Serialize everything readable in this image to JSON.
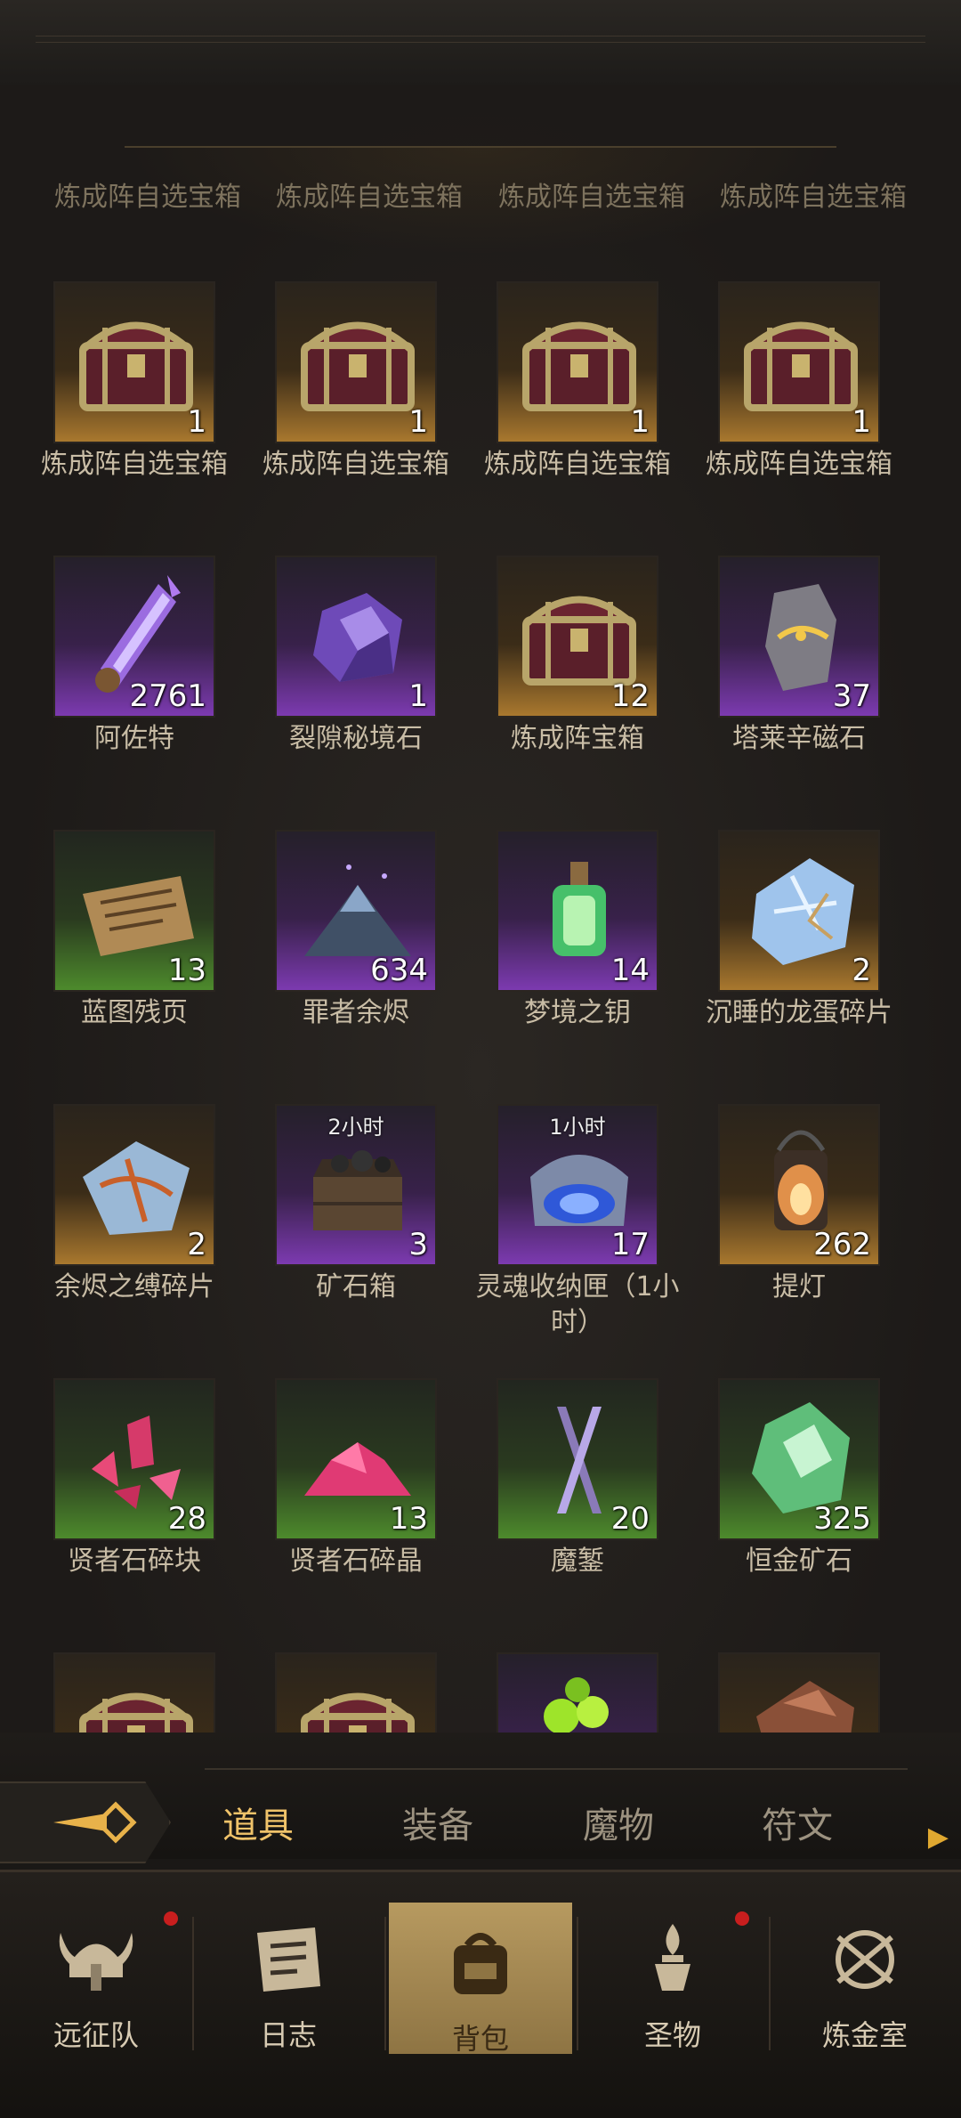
{
  "partial_row": [
    "炼成阵自选宝箱",
    "炼成阵自选宝箱",
    "炼成阵自选宝箱",
    "炼成阵自选宝箱"
  ],
  "items": [
    {
      "name": "炼成阵自选宝箱",
      "count": "1",
      "rarity": "gold",
      "icon": "treasure-chest-icon"
    },
    {
      "name": "炼成阵自选宝箱",
      "count": "1",
      "rarity": "gold",
      "icon": "treasure-chest-icon"
    },
    {
      "name": "炼成阵自选宝箱",
      "count": "1",
      "rarity": "gold",
      "icon": "treasure-chest-icon"
    },
    {
      "name": "炼成阵自选宝箱",
      "count": "1",
      "rarity": "gold",
      "icon": "treasure-chest-icon"
    },
    {
      "name": "阿佐特",
      "count": "2761",
      "rarity": "purple",
      "icon": "crystal-vial-icon"
    },
    {
      "name": "裂隙秘境石",
      "count": "1",
      "rarity": "purple",
      "icon": "amethyst-stone-icon"
    },
    {
      "name": "炼成阵宝箱",
      "count": "12",
      "rarity": "gold",
      "icon": "treasure-chest-icon"
    },
    {
      "name": "塔莱辛磁石",
      "count": "37",
      "rarity": "purple",
      "icon": "rune-stone-icon"
    },
    {
      "name": "蓝图残页",
      "count": "13",
      "rarity": "green",
      "icon": "scroll-page-icon"
    },
    {
      "name": "罪者余烬",
      "count": "634",
      "rarity": "purple",
      "icon": "ash-pile-icon"
    },
    {
      "name": "梦境之钥",
      "count": "14",
      "rarity": "purple",
      "icon": "green-lantern-vial-icon"
    },
    {
      "name": "沉睡的龙蛋碎片",
      "count": "2",
      "rarity": "gold",
      "icon": "dragon-egg-shard-icon"
    },
    {
      "name": "余烬之缚碎片",
      "count": "2",
      "rarity": "gold",
      "icon": "ember-shard-icon"
    },
    {
      "name": "矿石箱",
      "count": "3",
      "rarity": "purple",
      "icon": "ore-crate-icon",
      "timer": "2小时"
    },
    {
      "name": "灵魂收纳匣（1小时）",
      "count": "17",
      "rarity": "purple",
      "icon": "soul-casket-icon",
      "timer": "1小时"
    },
    {
      "name": "提灯",
      "count": "262",
      "rarity": "gold",
      "icon": "lantern-icon"
    },
    {
      "name": "贤者石碎块",
      "count": "28",
      "rarity": "green",
      "icon": "red-crystal-shards-icon"
    },
    {
      "name": "贤者石碎晶",
      "count": "13",
      "rarity": "green",
      "icon": "red-crystal-pile-icon"
    },
    {
      "name": "魔錾",
      "count": "20",
      "rarity": "green",
      "icon": "chisel-icon"
    },
    {
      "name": "恒金矿石",
      "count": "325",
      "rarity": "green",
      "icon": "green-ore-icon"
    },
    {
      "name": "",
      "count": "",
      "rarity": "gold",
      "icon": "treasure-chest-icon"
    },
    {
      "name": "",
      "count": "",
      "rarity": "gold",
      "icon": "treasure-chest-icon"
    },
    {
      "name": "",
      "count": "",
      "rarity": "purple",
      "icon": "green-orb-cluster-icon"
    },
    {
      "name": "",
      "count": "",
      "rarity": "gold",
      "icon": "copper-ore-icon"
    }
  ],
  "tabs": [
    {
      "label": "道具",
      "active": true
    },
    {
      "label": "装备",
      "active": false
    },
    {
      "label": "魔物",
      "active": false
    },
    {
      "label": "符文",
      "active": false
    }
  ],
  "back_icon": "back-arrow-icon",
  "next_icon": "chevron-right-icon",
  "nav": [
    {
      "label": "远征队",
      "icon": "viking-helmet-icon",
      "badge": true
    },
    {
      "label": "日志",
      "icon": "journal-icon",
      "badge": false
    },
    {
      "label": "背包",
      "icon": "backpack-icon",
      "badge": false,
      "active": true
    },
    {
      "label": "圣物",
      "icon": "relic-icon",
      "badge": true
    },
    {
      "label": "炼金室",
      "icon": "alchemy-icon",
      "badge": false
    }
  ],
  "colors": {
    "accent": "#f0c36a",
    "badge": "#c81e1e",
    "gold_tile": "#a9782e",
    "purple_tile": "#7c3ab0",
    "green_tile": "#4d8a2c"
  }
}
